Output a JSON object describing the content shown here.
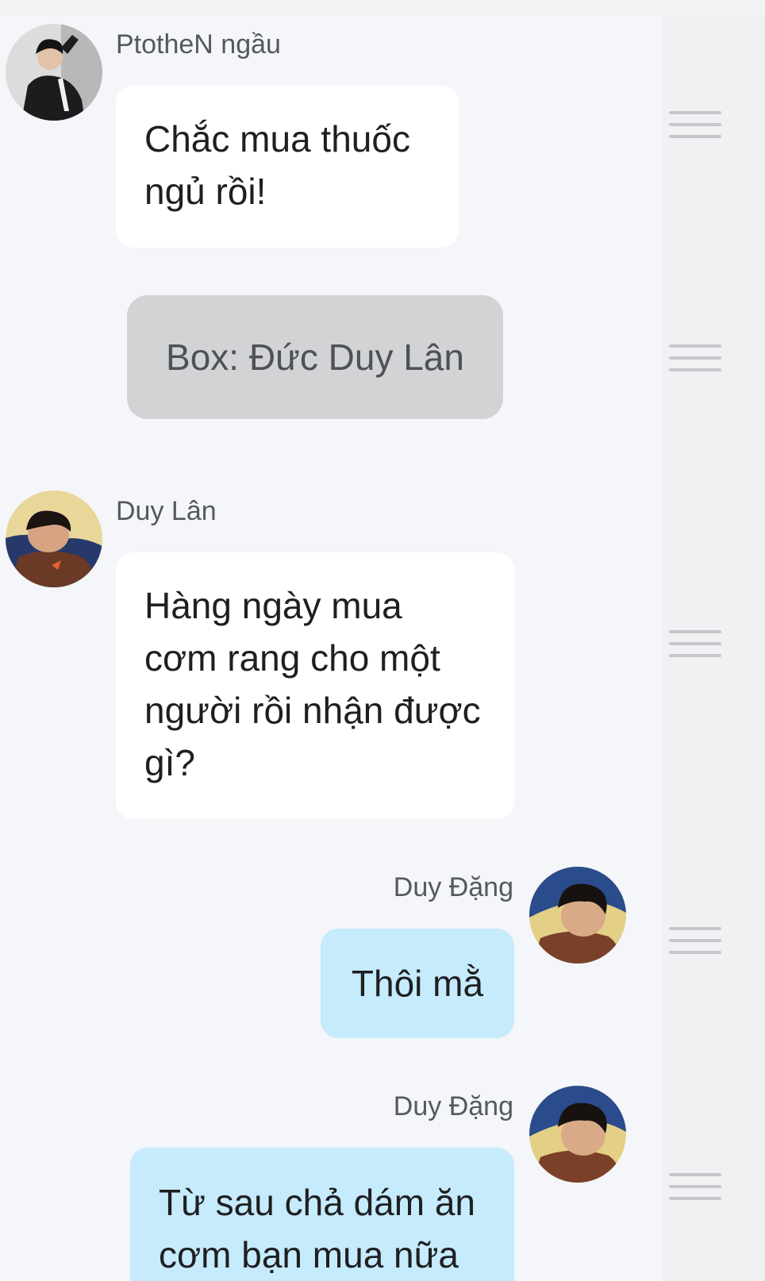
{
  "conversation": {
    "messages": [
      {
        "sender": "PtotheN ngầu",
        "text": "Chắc mua thuốc\nngủ rồi!"
      },
      {
        "sender": "Duy Lân",
        "text": "Hàng ngày mua\ncơm rang cho một\nngười rồi nhận được\ngì?"
      },
      {
        "sender": "Duy Đặng",
        "text": "Thôi mằ"
      },
      {
        "sender": "Duy Đặng",
        "text": "Từ sau chả dám ăn\ncơm bạn mua nữa"
      }
    ],
    "system_notice": "Box: Đức Duy Lân"
  },
  "icons": {
    "drag_handle": "drag-handle-icon",
    "avatar_ptothen": "avatar-ptothen",
    "avatar_duy_lan": "avatar-duy-lan",
    "avatar_duy_dang": "avatar-duy-dang"
  },
  "colors": {
    "incoming_bubble": "#ffffff",
    "outgoing_bubble": "#c6ebfc",
    "system_bubble": "#d2d3d5",
    "chat_background": "#f4f6f9"
  }
}
